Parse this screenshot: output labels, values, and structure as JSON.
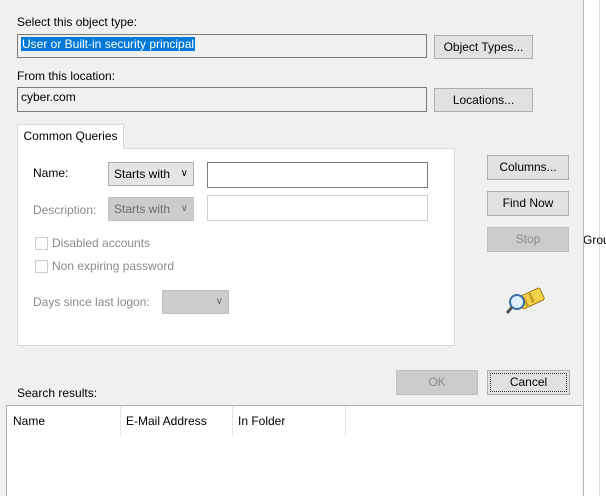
{
  "object_type": {
    "label": "Select this object type:",
    "value": "User or Built-in security principal",
    "button": "Object Types..."
  },
  "location": {
    "label": "From this location:",
    "value": "cyber.com",
    "button": "Locations..."
  },
  "tabs": [
    {
      "label": "Common Queries"
    }
  ],
  "queries": {
    "name_label": "Name:",
    "name_mode": "Starts with",
    "name_value": "",
    "description_label": "Description:",
    "description_mode": "Starts with",
    "description_value": "",
    "disabled_accounts_label": "Disabled accounts",
    "non_expiring_label": "Non expiring password",
    "days_label": "Days since last logon:",
    "days_value": ""
  },
  "side_buttons": {
    "columns": "Columns...",
    "find_now": "Find Now",
    "stop": "Stop"
  },
  "background_window": {
    "partial_text": "Grou"
  },
  "footer": {
    "ok": "OK",
    "cancel": "Cancel",
    "results_label": "Search results:"
  },
  "results_columns": [
    "Name",
    "E-Mail Address",
    "In Folder"
  ],
  "icons": {
    "search_flashlight": "flashlight-search-icon"
  },
  "colors": {
    "selection": "#0078d7",
    "dialog_bg": "#f0f0f0"
  }
}
